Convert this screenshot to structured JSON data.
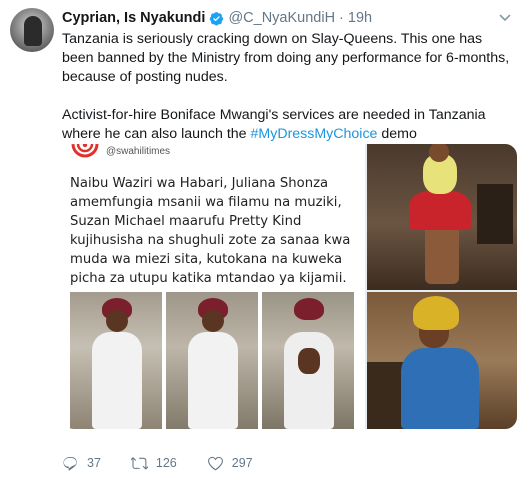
{
  "tweet": {
    "author_name": "Cyprian, Is Nyakundi",
    "handle": "@C_NyaKundiH",
    "separator": "·",
    "time": "19h",
    "paragraph1": "Tanzania is seriously cracking down on Slay-Queens. This one has been banned by the Ministry from doing any performance for 6-months, because of posting nudes.",
    "paragraph2_before": "Activist-for-hire Boniface Mwangi's services are needed in Tanzania where he can also launch the ",
    "hashtag": "#MyDressMyChoice",
    "paragraph2_after": " demo"
  },
  "media": {
    "source_handle": "@swahilitimes",
    "caption": "Naibu Waziri wa Habari, Juliana Shonza amemfungia msanii wa filamu na muziki, Suzan Michael maarufu Pretty Kind kujihusisha na shughuli zote za sanaa kwa muda wa miezi sita, kutokana na kuweka picha za utupu katika mtandao ya kijamii."
  },
  "actions": {
    "replies": "37",
    "retweets": "126",
    "likes": "297"
  },
  "colors": {
    "link": "#1b95e0",
    "verified": "#1da1f2",
    "muted": "#657786",
    "swahilitimes_red": "#e2312d"
  },
  "icons": {
    "verified": "verified-badge-icon",
    "caret": "chevron-down-icon",
    "reply": "reply-icon",
    "retweet": "retweet-icon",
    "like": "heart-icon"
  }
}
